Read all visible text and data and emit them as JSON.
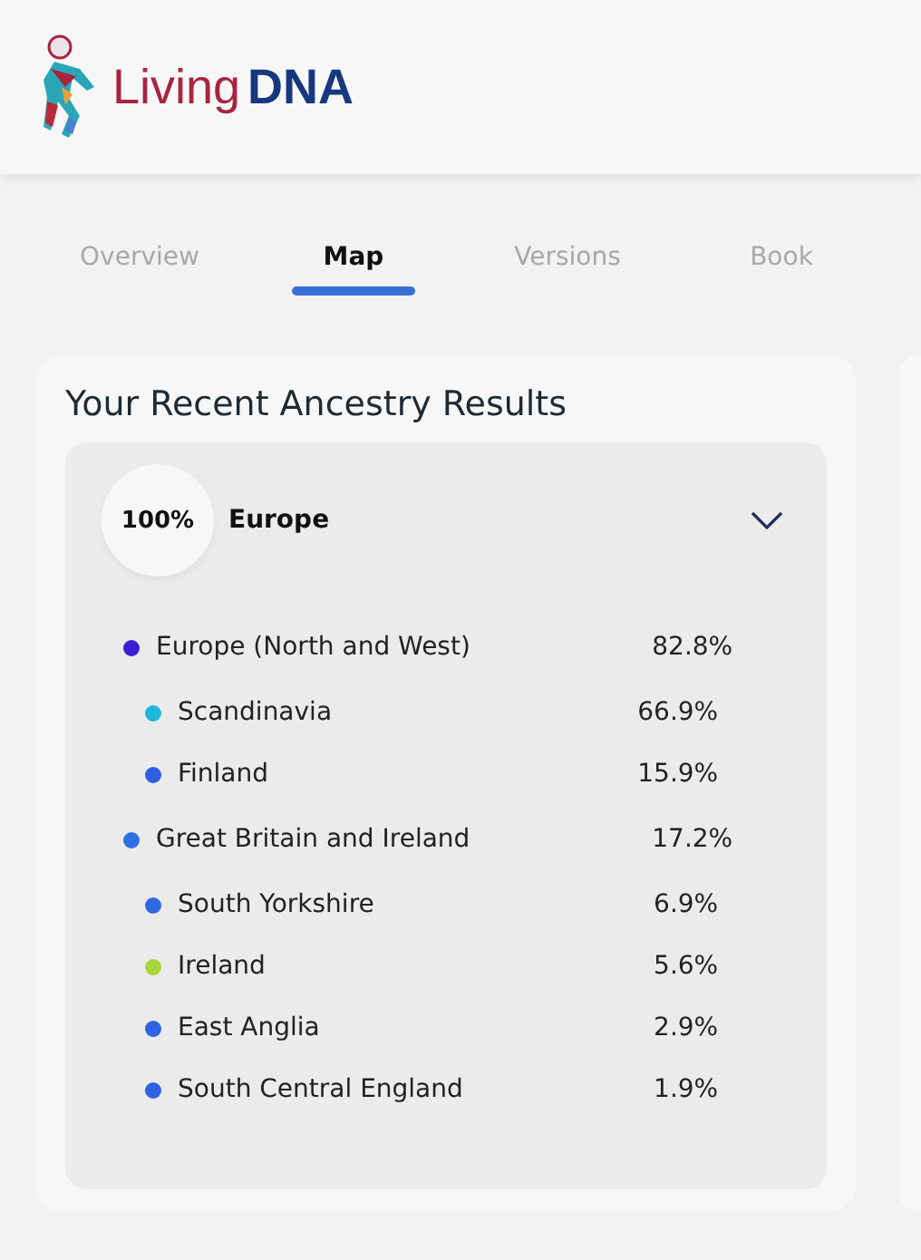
{
  "logo": {
    "word_1": "Living",
    "word_2": "DNA"
  },
  "tabs": [
    {
      "label": "Overview",
      "selected": false
    },
    {
      "label": "Map",
      "selected": true
    },
    {
      "label": "Versions",
      "selected": false
    },
    {
      "label": "Book",
      "selected": false
    }
  ],
  "card": {
    "title": "Your Recent Ancestry Results",
    "group": {
      "percent": "100%",
      "name": "Europe",
      "expanded": true,
      "regions": [
        {
          "name": "Europe (North and West)",
          "percent": "82.8%",
          "color": "#3a1fd1",
          "children": [
            {
              "name": "Scandinavia",
              "percent": "66.9%",
              "color": "#1fb6db"
            },
            {
              "name": "Finland",
              "percent": "15.9%",
              "color": "#2f5fe0"
            }
          ]
        },
        {
          "name": "Great Britain and Ireland",
          "percent": "17.2%",
          "color": "#2f6fe6",
          "children": [
            {
              "name": "South Yorkshire",
              "percent": "6.9%",
              "color": "#2f6ae3"
            },
            {
              "name": "Ireland",
              "percent": "5.6%",
              "color": "#a8d63c"
            },
            {
              "name": "East Anglia",
              "percent": "2.9%",
              "color": "#2f63e0"
            },
            {
              "name": "South Central England",
              "percent": "1.9%",
              "color": "#2f63e0"
            }
          ]
        }
      ]
    }
  }
}
